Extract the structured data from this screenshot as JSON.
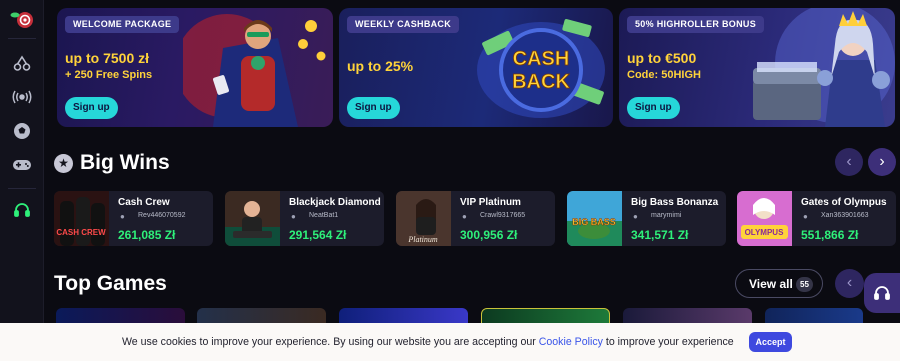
{
  "sidebar": {
    "items": [
      {
        "icon": "logo-icon"
      },
      {
        "icon": "cherries-icon"
      },
      {
        "icon": "live-broadcast-icon"
      },
      {
        "icon": "soccer-ball-icon"
      },
      {
        "icon": "gamepad-icon"
      },
      {
        "icon": "headset-icon"
      }
    ]
  },
  "promos": [
    {
      "tag": "WELCOME PACKAGE",
      "headline": "up to 7500 zł",
      "sub": "+ 250 Free Spins",
      "button": "Sign up"
    },
    {
      "tag": "WEEKLY CASHBACK",
      "headline": "up to 25%",
      "sub": "",
      "button": "Sign up",
      "art_text": [
        "CASH",
        "BACK"
      ]
    },
    {
      "tag": "50% HIGHROLLER BONUS",
      "headline": "up to €500",
      "sub": "Code: 50HIGH",
      "button": "Sign up"
    }
  ],
  "big_wins": {
    "title": "Big Wins",
    "prev": "‹",
    "next": "›",
    "items": [
      {
        "game": "Cash Crew",
        "user": "Rev446070592",
        "amount": "261,085 Zł",
        "thumb_text": "CASH CREW",
        "thumb_color": "#2a1212"
      },
      {
        "game": "Blackjack Diamond",
        "user": "NeatBat1",
        "amount": "291,564 Zł",
        "thumb_text": "",
        "thumb_color": "#3b2a22"
      },
      {
        "game": "VIP Platinum",
        "user": "Crawl9317665",
        "amount": "300,956 Zł",
        "thumb_text": "Platinum",
        "thumb_color": "#4a352d"
      },
      {
        "game": "Big Bass Bonanza",
        "user": "marymimi",
        "amount": "341,571 Zł",
        "thumb_text": "BIG BASS",
        "thumb_color": "#1f8a5b"
      },
      {
        "game": "Gates of Olympus",
        "user": "Xan363901663",
        "amount": "551,866 Zł",
        "thumb_text": "OLYMPUS",
        "thumb_color": "#d76dd0"
      }
    ]
  },
  "top_games": {
    "title": "Top Games",
    "view_all": "View all",
    "count": "55",
    "prev": "‹"
  },
  "cookie": {
    "text_before": "We use cookies to improve your experience. By using our website you are accepting our",
    "link": "Cookie Policy",
    "text_after": "to improve your experience",
    "accept": "Accept"
  },
  "colors": {
    "accent": "#26d7d9",
    "gold": "#ffd33a",
    "win_green": "#2ef07a",
    "nav_purple": "#3d2f79",
    "accept_blue": "#3e49df"
  }
}
